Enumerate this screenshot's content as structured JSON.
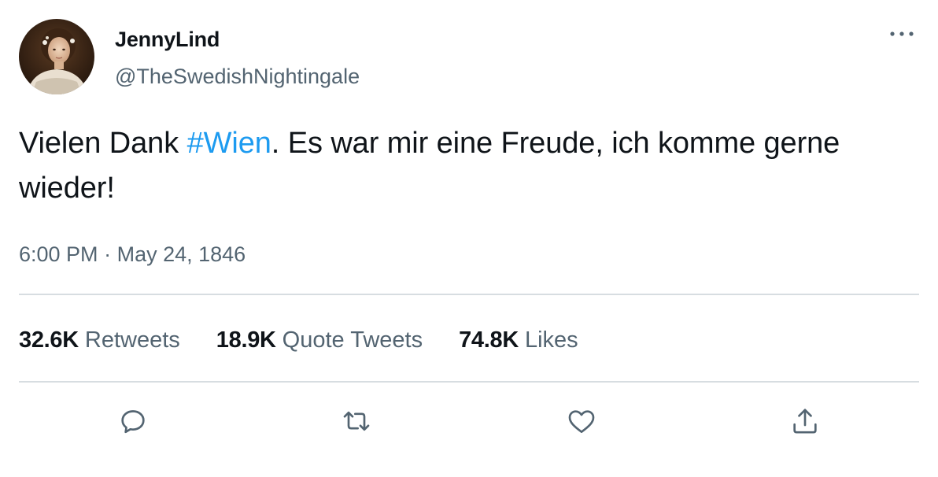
{
  "author": {
    "display_name": "JennyLind",
    "handle": "@TheSwedishNightingale",
    "avatar_icon": "portrait-avatar"
  },
  "tweet": {
    "text_before": "Vielen Dank ",
    "hashtag": "#Wien",
    "text_after": ". Es war mir eine Freude, ich komme gerne wieder!",
    "time": "6:00 PM",
    "separator": "·",
    "date": "May 24, 1846"
  },
  "stats": {
    "retweets_count": "32.6K",
    "retweets_label": "Retweets",
    "quote_tweets_count": "18.9K",
    "quote_tweets_label": "Quote Tweets",
    "likes_count": "74.8K",
    "likes_label": "Likes"
  },
  "actions": {
    "reply_icon": "reply-icon",
    "retweet_icon": "retweet-icon",
    "like_icon": "heart-icon",
    "share_icon": "share-icon",
    "more_icon": "more-options-icon"
  },
  "colors": {
    "text_primary": "#0f1419",
    "text_secondary": "#536471",
    "link": "#1d9bf0",
    "divider": "#d7dde1",
    "icon": "#536471"
  }
}
